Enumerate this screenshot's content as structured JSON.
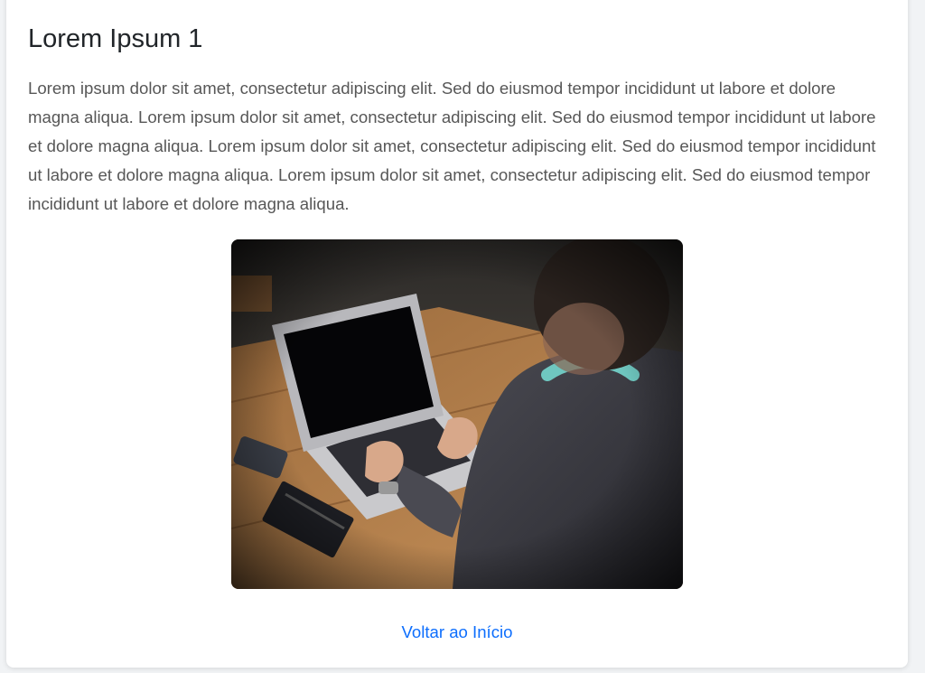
{
  "article": {
    "title": "Lorem Ipsum 1",
    "body": "Lorem ipsum dolor sit amet, consectetur adipiscing elit. Sed do eiusmod tempor incididunt ut labore et dolore magna aliqua. Lorem ipsum dolor sit amet, consectetur adipiscing elit. Sed do eiusmod tempor incididunt ut labore et dolore magna aliqua. Lorem ipsum dolor sit amet, consectetur adipiscing elit. Sed do eiusmod tempor incididunt ut labore et dolore magna aliqua. Lorem ipsum dolor sit amet, consectetur adipiscing elit. Sed do eiusmod tempor incididunt ut labore et dolore magna aliqua.",
    "image_icon": "photo-person-laptop-icon"
  },
  "footer": {
    "back_link_label": "Voltar ao Início"
  },
  "colors": {
    "link": "#0d6efd",
    "heading": "#212529",
    "body_text": "#575757"
  }
}
